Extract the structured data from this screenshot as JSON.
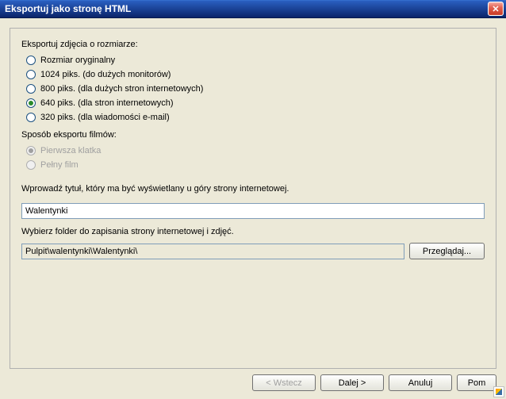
{
  "window": {
    "title": "Eksportuj jako stronę HTML"
  },
  "size_section": {
    "label": "Eksportuj zdjęcia o rozmiarze:",
    "options": [
      {
        "label": "Rozmiar oryginalny",
        "selected": false
      },
      {
        "label": "1024 piks. (do dużych monitorów)",
        "selected": false
      },
      {
        "label": "800 piks. (dla dużych stron internetowych)",
        "selected": false
      },
      {
        "label": "640 piks. (dla stron internetowych)",
        "selected": true
      },
      {
        "label": "320 piks. (dla wiadomości e-mail)",
        "selected": false
      }
    ]
  },
  "movie_section": {
    "label": "Sposób eksportu filmów:",
    "options": [
      {
        "label": "Pierwsza klatka",
        "selected": true,
        "disabled": true
      },
      {
        "label": "Pełny film",
        "selected": false,
        "disabled": true
      }
    ]
  },
  "title_section": {
    "label": "Wprowadź tytuł, który ma być wyświetlany u góry strony internetowej.",
    "value": "Walentynki"
  },
  "folder_section": {
    "label": "Wybierz folder do zapisania strony internetowej i zdjęć.",
    "value": "Pulpit\\walentynki\\Walentynki\\",
    "browse": "Przeglądaj..."
  },
  "footer": {
    "back": "< Wstecz",
    "next": "Dalej >",
    "cancel": "Anuluj",
    "help": "Pom"
  }
}
